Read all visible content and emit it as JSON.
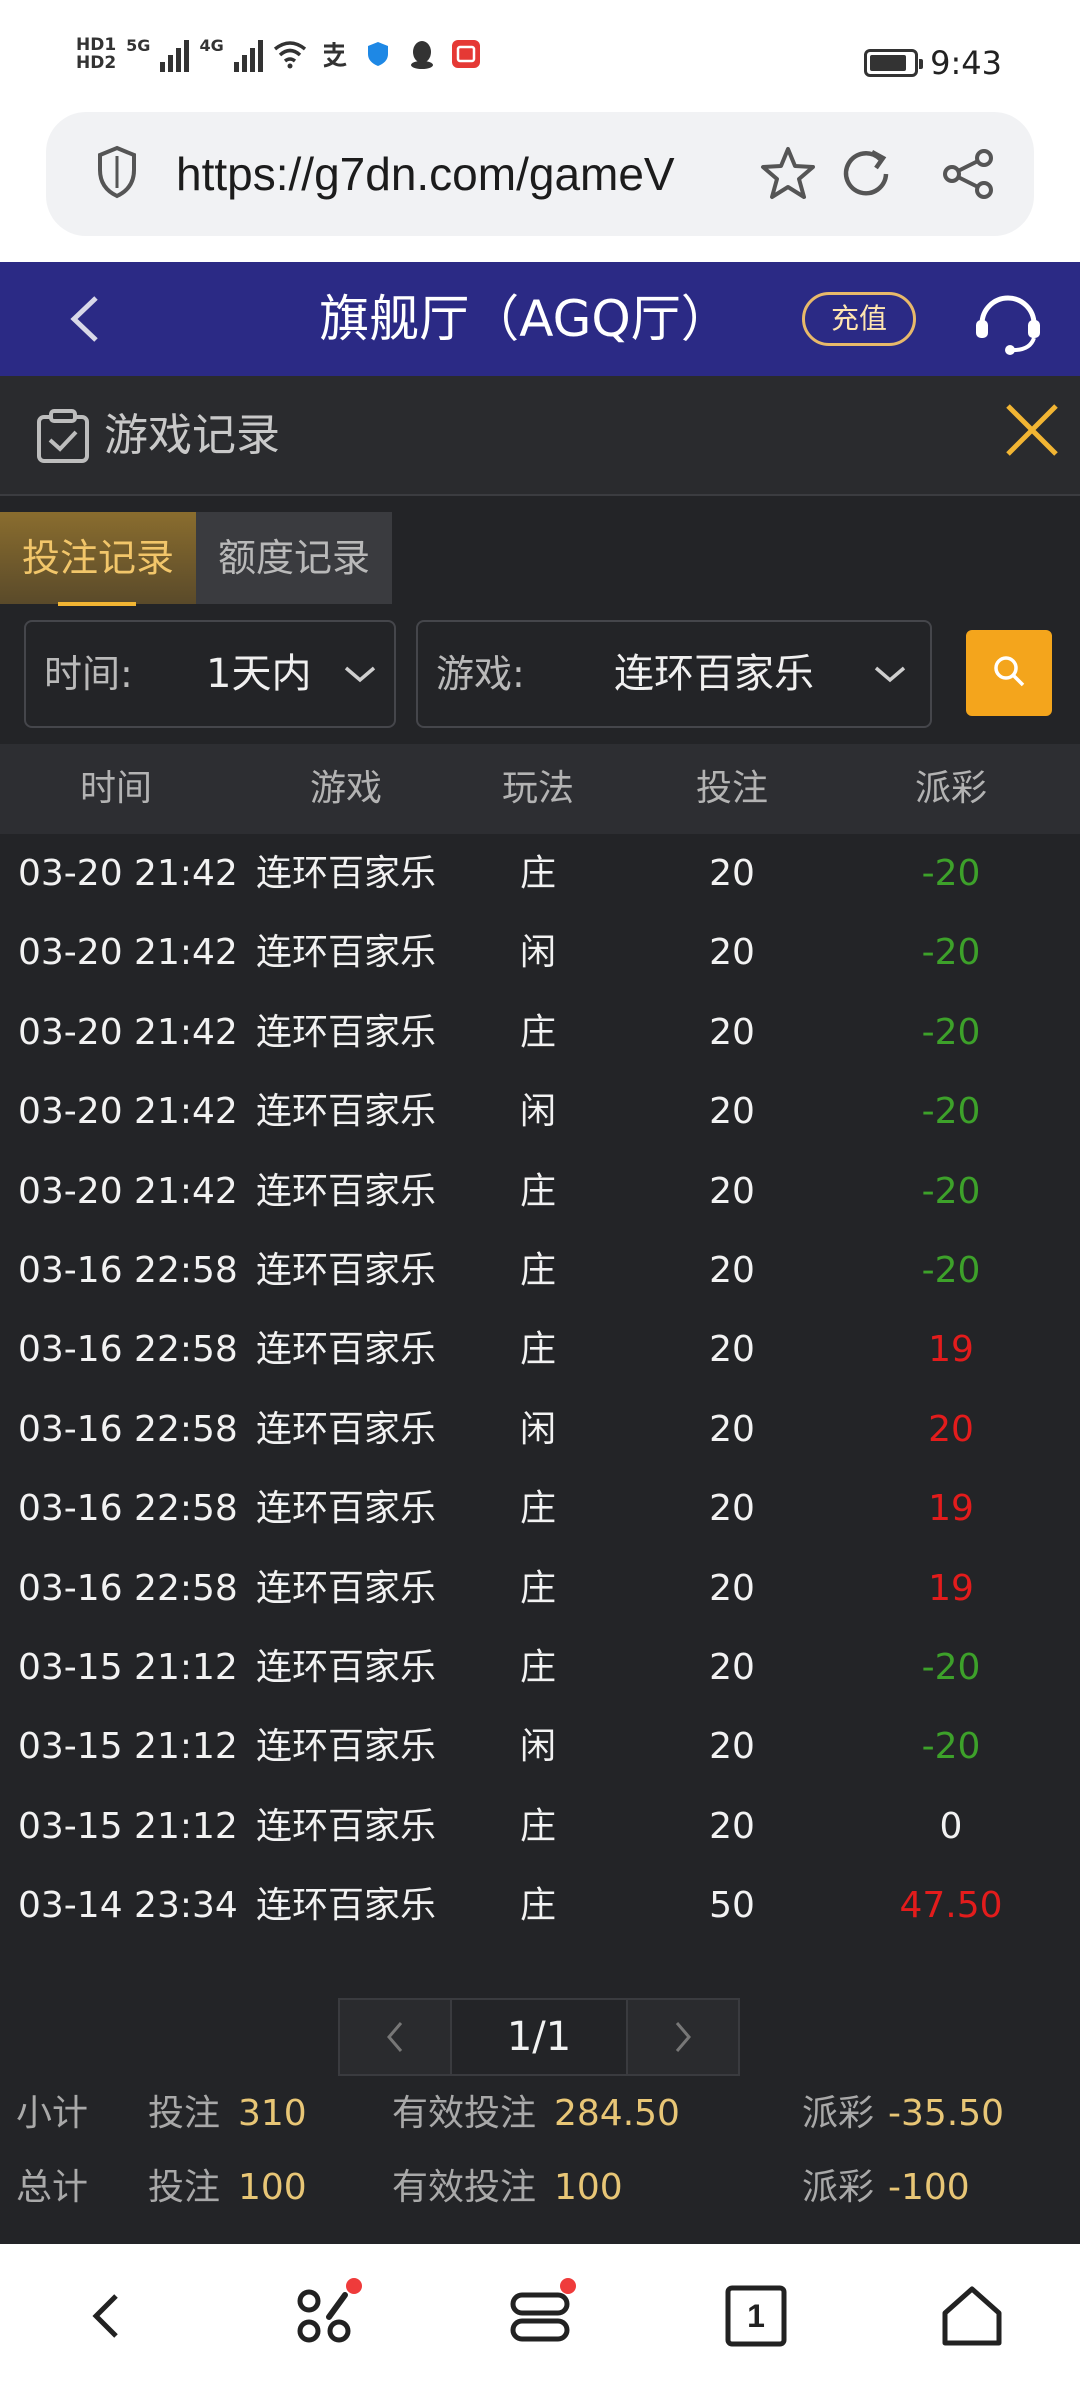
{
  "status_bar": {
    "hd1": "HD1",
    "hd2": "HD2",
    "net1": "5G",
    "net2": "4G",
    "time": "9:43",
    "battery_level": 0.85
  },
  "browser": {
    "url": "https://g7dn.com/gameV"
  },
  "header": {
    "title": "旗舰厅（AGQ厅）",
    "recharge_label": "充值"
  },
  "panel": {
    "title": "游戏记录"
  },
  "tabs": [
    {
      "label": "投注记录",
      "active": true
    },
    {
      "label": "额度记录",
      "active": false
    }
  ],
  "filters": {
    "time_label": "时间:",
    "time_value": "1天内",
    "game_label": "游戏:",
    "game_value": "连环百家乐"
  },
  "table": {
    "columns": [
      "时间",
      "游戏",
      "玩法",
      "投注",
      "派彩"
    ],
    "rows": [
      {
        "time": "03-20 21:42",
        "game": "连环百家乐",
        "play": "庄",
        "bet": "20",
        "payout": "-20",
        "tone": "neg"
      },
      {
        "time": "03-20 21:42",
        "game": "连环百家乐",
        "play": "闲",
        "bet": "20",
        "payout": "-20",
        "tone": "neg"
      },
      {
        "time": "03-20 21:42",
        "game": "连环百家乐",
        "play": "庄",
        "bet": "20",
        "payout": "-20",
        "tone": "neg"
      },
      {
        "time": "03-20 21:42",
        "game": "连环百家乐",
        "play": "闲",
        "bet": "20",
        "payout": "-20",
        "tone": "neg"
      },
      {
        "time": "03-20 21:42",
        "game": "连环百家乐",
        "play": "庄",
        "bet": "20",
        "payout": "-20",
        "tone": "neg"
      },
      {
        "time": "03-16 22:58",
        "game": "连环百家乐",
        "play": "庄",
        "bet": "20",
        "payout": "-20",
        "tone": "neg"
      },
      {
        "time": "03-16 22:58",
        "game": "连环百家乐",
        "play": "庄",
        "bet": "20",
        "payout": "19",
        "tone": "pos"
      },
      {
        "time": "03-16 22:58",
        "game": "连环百家乐",
        "play": "闲",
        "bet": "20",
        "payout": "20",
        "tone": "pos"
      },
      {
        "time": "03-16 22:58",
        "game": "连环百家乐",
        "play": "庄",
        "bet": "20",
        "payout": "19",
        "tone": "pos"
      },
      {
        "time": "03-16 22:58",
        "game": "连环百家乐",
        "play": "庄",
        "bet": "20",
        "payout": "19",
        "tone": "pos"
      },
      {
        "time": "03-15 21:12",
        "game": "连环百家乐",
        "play": "庄",
        "bet": "20",
        "payout": "-20",
        "tone": "neg"
      },
      {
        "time": "03-15 21:12",
        "game": "连环百家乐",
        "play": "闲",
        "bet": "20",
        "payout": "-20",
        "tone": "neg"
      },
      {
        "time": "03-15 21:12",
        "game": "连环百家乐",
        "play": "庄",
        "bet": "20",
        "payout": "0",
        "tone": "zero"
      },
      {
        "time": "03-14 23:34",
        "game": "连环百家乐",
        "play": "庄",
        "bet": "50",
        "payout": "47.50",
        "tone": "pos"
      }
    ]
  },
  "pagination": {
    "current": "1/1"
  },
  "subtotal": {
    "label": "小计",
    "bet_label": "投注",
    "bet_value": "310",
    "valid_label": "有效投注",
    "valid_value": "284.50",
    "payout_label": "派彩",
    "payout_value": "-35.50"
  },
  "total": {
    "label": "总计",
    "bet_label": "投注",
    "bet_value": "100",
    "valid_label": "有效投注",
    "valid_value": "100",
    "payout_label": "派彩",
    "payout_value": "-100"
  },
  "bottom_nav": {
    "tabs_count": "1"
  },
  "colors": {
    "header_bg": "#2b2a85",
    "body_bg": "#232427",
    "accent": "#f4a51c",
    "negative": "#3da12a",
    "positive": "#e31c1c",
    "gold_text": "#e8c676"
  }
}
